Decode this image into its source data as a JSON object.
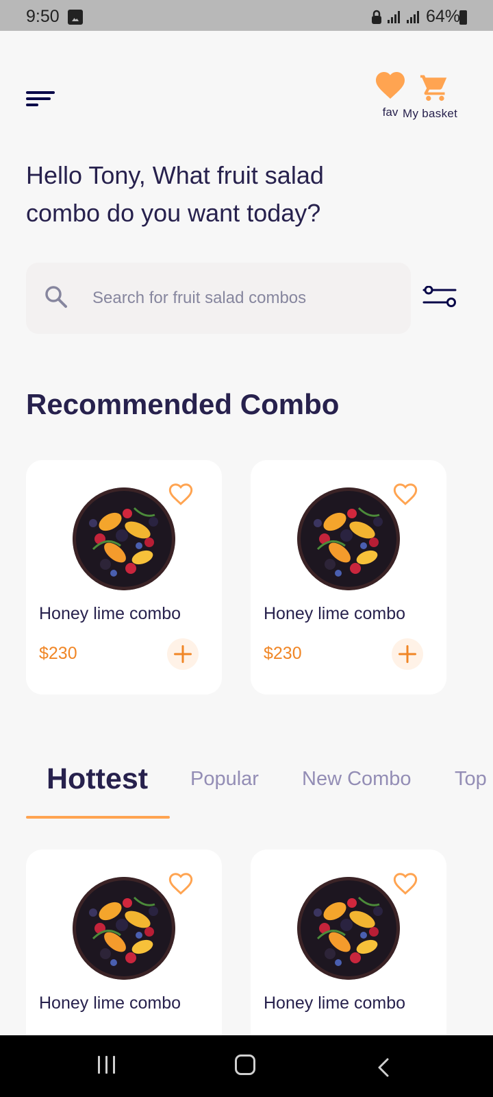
{
  "status_bar": {
    "time": "9:50",
    "battery": "64%",
    "icons": [
      "image-icon",
      "lock-icon",
      "signal-icon",
      "signal-icon",
      "battery-icon"
    ]
  },
  "header": {
    "fav_label": "fav",
    "basket_label": "My basket",
    "accent_color": "#FFA451"
  },
  "greeting": "Hello Tony, What fruit salad\n combo do you want today?",
  "search": {
    "placeholder": "Search for fruit salad combos"
  },
  "recommended": {
    "title": "Recommended Combo",
    "items": [
      {
        "name": "Honey lime combo",
        "price": "$230"
      },
      {
        "name": "Honey lime combo",
        "price": "$230"
      }
    ]
  },
  "tabs": {
    "items": [
      "Hottest",
      "Popular",
      "New Combo",
      "Top"
    ],
    "active": "Hottest"
  },
  "hottest": {
    "items": [
      {
        "name": "Honey lime combo"
      },
      {
        "name": "Honey lime combo"
      }
    ]
  }
}
